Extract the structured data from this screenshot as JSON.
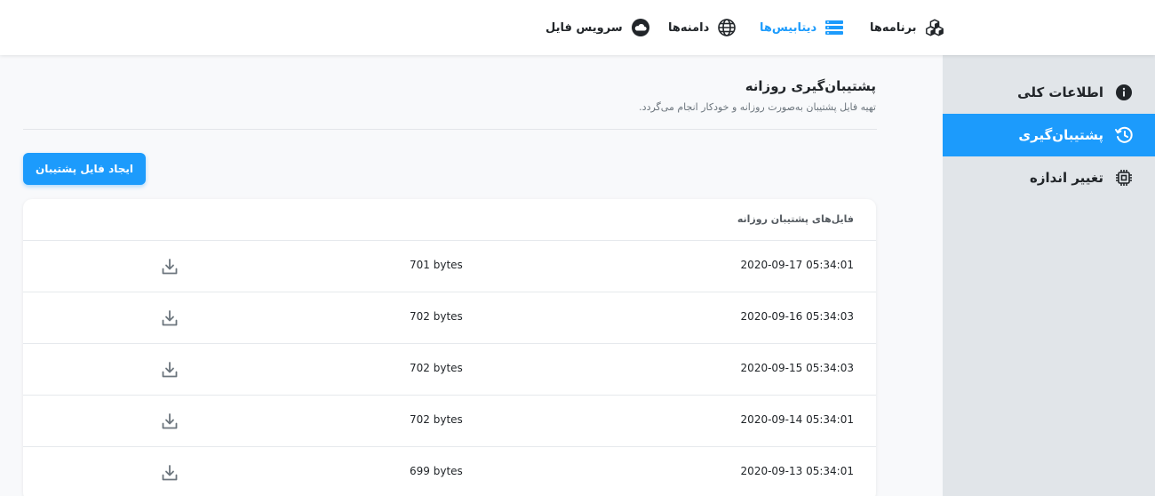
{
  "nav": {
    "items": [
      {
        "label": "برنامه‌ها",
        "icon": "cubes-icon",
        "active": false
      },
      {
        "label": "دیتابیس‌ها",
        "icon": "database-icon",
        "active": true
      },
      {
        "label": "دامنه‌ها",
        "icon": "globe-icon",
        "active": false
      },
      {
        "label": "سرویس فایل",
        "icon": "cloud-icon",
        "active": false
      }
    ]
  },
  "sidebar": {
    "items": [
      {
        "label": "اطلاعات کلی",
        "icon": "info-icon",
        "active": false
      },
      {
        "label": "پشتیبان‌گیری",
        "icon": "history-icon",
        "active": true
      },
      {
        "label": "تغییر اندازه",
        "icon": "chip-icon",
        "active": false
      }
    ]
  },
  "main": {
    "title": "پشتیبان‌گیری روزانه",
    "subtitle": "تهیه فایل پشتیبان به‌صورت روزانه و خودکار انجام می‌گردد.",
    "create_button": "ایجاد فایل پشتیبان"
  },
  "backups": {
    "header": "فایل‌های پشتیبان روزانه",
    "rows": [
      {
        "date": "2020-09-17 05:34:01",
        "size": "701 bytes"
      },
      {
        "date": "2020-09-16 05:34:03",
        "size": "702 bytes"
      },
      {
        "date": "2020-09-15 05:34:03",
        "size": "702 bytes"
      },
      {
        "date": "2020-09-14 05:34:01",
        "size": "702 bytes"
      },
      {
        "date": "2020-09-13 05:34:01",
        "size": "699 bytes"
      }
    ]
  },
  "colors": {
    "accent": "#1c9bfc",
    "sidebar_bg": "#e1e5e9",
    "page_bg": "#f8f9fb"
  }
}
